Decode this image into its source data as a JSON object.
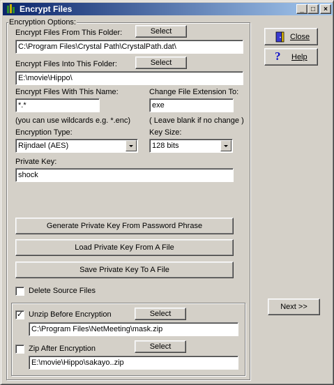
{
  "window": {
    "title": "Encrypt Files",
    "min": "_",
    "max": "□",
    "close": "×"
  },
  "group": {
    "legend": "Encryption Options:"
  },
  "from_folder": {
    "label": "Encrypt Files From This Folder:",
    "select": "Select",
    "value": "C:\\Program Files\\Crystal Path\\CrystalPath.dat\\"
  },
  "into_folder": {
    "label": "Encrypt Files Into This Folder:",
    "select": "Select",
    "value": "E:\\movie\\Hippo\\"
  },
  "name": {
    "label": "Encrypt Files With This Name:",
    "value": "*.*",
    "hint": "(you can use wildcards e.g. *.enc)"
  },
  "extension": {
    "label": "Change File Extension To:",
    "value": "exe",
    "hint": "( Leave blank if no change )"
  },
  "enc_type": {
    "label": "Encryption Type:",
    "value": "Rijndael (AES)"
  },
  "key_size": {
    "label": "Key Size:",
    "value": "128 bits"
  },
  "private_key": {
    "label": "Private Key:",
    "value": "shock"
  },
  "buttons": {
    "generate": "Generate Private Key From Password Phrase",
    "load": "Load Private Key From A File",
    "save": "Save Private Key To A File"
  },
  "delete_source": {
    "label": "Delete Source Files",
    "checked": false
  },
  "unzip": {
    "label": "Unzip Before Encryption",
    "checked": true,
    "mark": "✓",
    "select": "Select",
    "value": "C:\\Program Files\\NetMeeting\\mask.zip"
  },
  "zip": {
    "label": "Zip After Encryption",
    "checked": false,
    "select": "Select",
    "value": "E:\\movie\\Hippo\\sakayo..zip"
  },
  "side": {
    "close": "Close",
    "help": "Help",
    "next": "Next >>"
  },
  "colors": {
    "titlebar_start": "#0a246a",
    "titlebar_end": "#a6caf0",
    "face": "#d4d0c8"
  }
}
